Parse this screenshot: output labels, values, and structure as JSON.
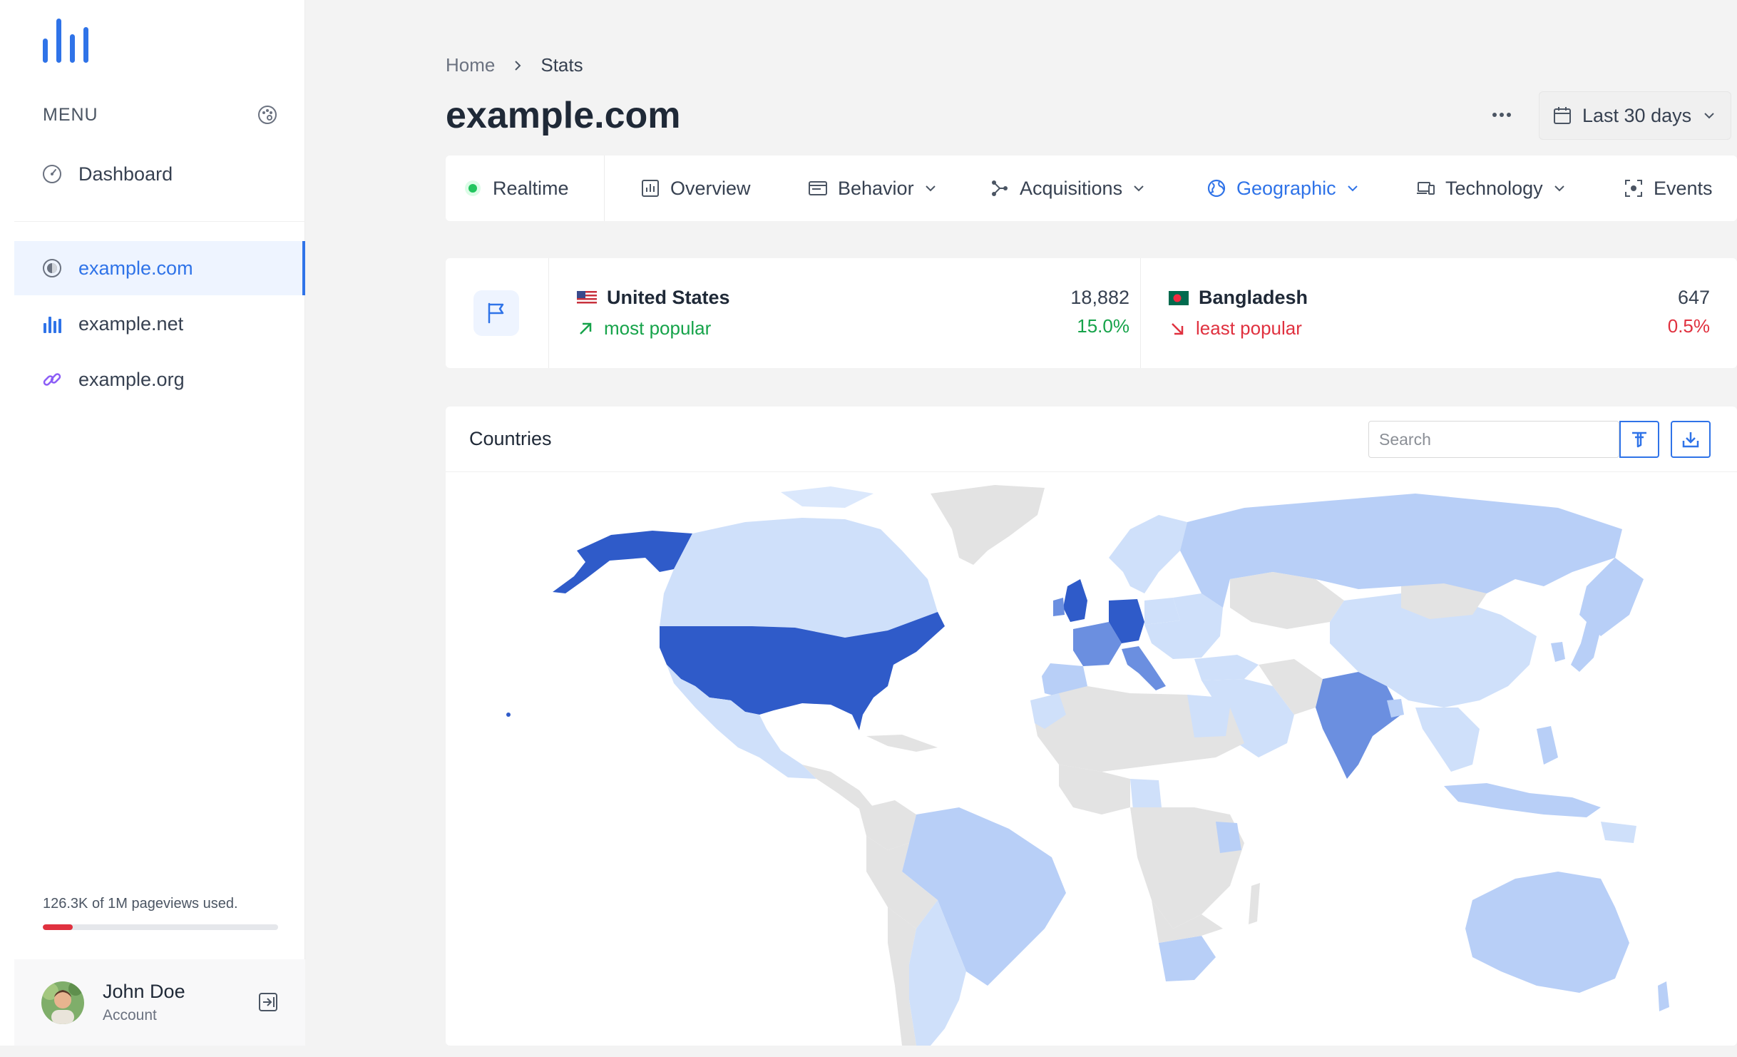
{
  "sidebar": {
    "menu_label": "MENU",
    "items": [
      {
        "label": "Dashboard",
        "icon": "gauge-icon"
      },
      {
        "label": "example.com",
        "icon": "site-icon",
        "active": true
      },
      {
        "label": "example.net",
        "icon": "bar-chart-icon"
      },
      {
        "label": "example.org",
        "icon": "link-icon"
      }
    ],
    "usage_text": "126.3K of 1M pageviews used.",
    "usage_fraction": 0.1263,
    "account": {
      "name": "John Doe",
      "subtitle": "Account"
    }
  },
  "breadcrumb": {
    "home": "Home",
    "current": "Stats"
  },
  "page_title": "example.com",
  "date_range": "Last 30 days",
  "tabs": [
    {
      "label": "Realtime",
      "icon": "live-dot-icon"
    },
    {
      "label": "Overview",
      "icon": "overview-icon"
    },
    {
      "label": "Behavior",
      "icon": "browser-window-icon"
    },
    {
      "label": "Acquisitions",
      "icon": "branch-icon"
    },
    {
      "label": "Geographic",
      "icon": "globe-icon",
      "active": true
    },
    {
      "label": "Technology",
      "icon": "devices-icon"
    },
    {
      "label": "Events",
      "icon": "target-icon"
    }
  ],
  "summary": {
    "most": {
      "country": "United States",
      "label": "most popular",
      "value": "18,882",
      "percent": "15.0%"
    },
    "least": {
      "country": "Bangladesh",
      "label": "least popular",
      "value": "647",
      "percent": "0.5%"
    }
  },
  "countries": {
    "title": "Countries",
    "search_placeholder": "Search"
  },
  "colors": {
    "accent": "#2f73e8",
    "map_dark": "#2f5bc9",
    "map_mid": "#6b8fe0",
    "map_light": "#b8cff7",
    "map_pale": "#cfe0fa",
    "map_none": "#e3e3e3"
  }
}
